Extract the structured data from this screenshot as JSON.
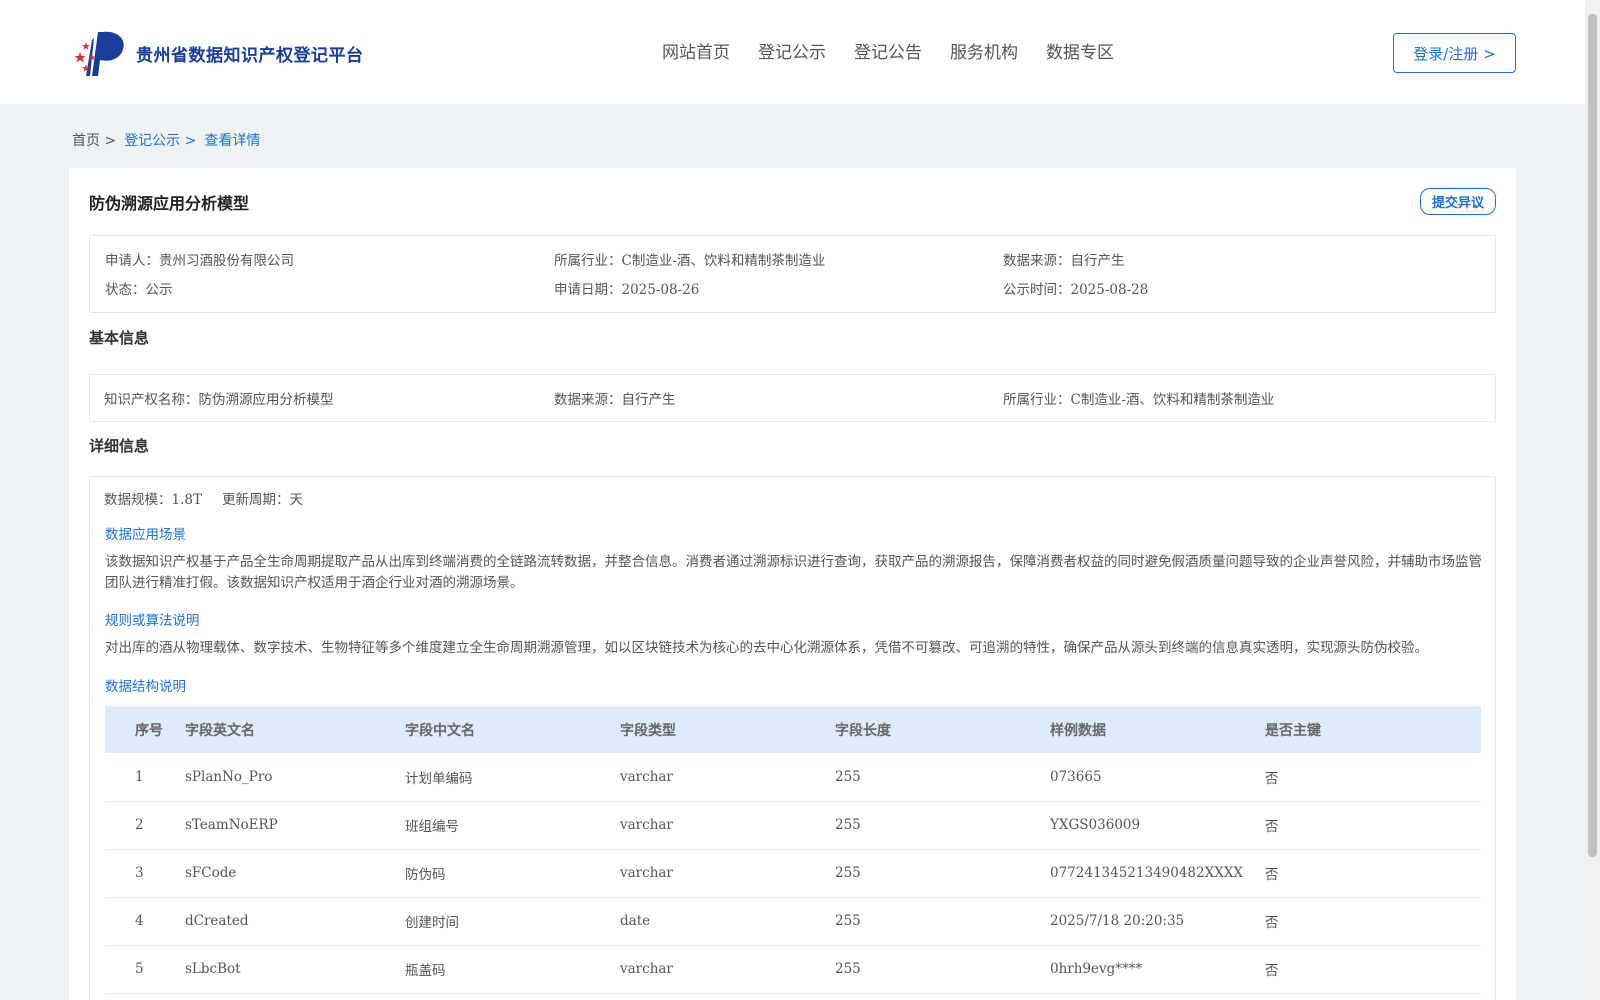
{
  "header": {
    "site_title": "贵州省数据知识产权登记平台",
    "nav": [
      "网站首页",
      "登记公示",
      "登记公告",
      "服务机构",
      "数据专区"
    ],
    "login_label": "登录/注册 >"
  },
  "breadcrumb": [
    "首页 >",
    "登记公示 >",
    "查看详情"
  ],
  "record": {
    "title": "防伪溯源应用分析模型",
    "objection_label": "提交异议",
    "summary": {
      "applicant_label": "申请人：",
      "applicant": "贵州习酒股份有限公司",
      "industry_label": "所属行业：",
      "industry": "C制造业-酒、饮料和精制茶制造业",
      "source_label": "数据来源：",
      "source": "自行产生",
      "status_label": "状态：",
      "status": "公示",
      "apply_date_label": "申请日期：",
      "apply_date": "2025-08-26",
      "publish_date_label": "公示时间：",
      "publish_date": "2025-08-28"
    }
  },
  "basic": {
    "title": "基本信息",
    "ip_name_label": "知识产权名称：",
    "ip_name": "防伪溯源应用分析模型",
    "source_label": "数据来源：",
    "source": "自行产生",
    "industry_label": "所属行业：",
    "industry": "C制造业-酒、饮料和精制茶制造业"
  },
  "detail": {
    "title": "详细信息",
    "scale_label": "数据规模：",
    "scale": "1.8T",
    "cycle_label": "更新周期：",
    "cycle": "天",
    "scenario_title": "数据应用场景",
    "scenario_text": "该数据知识产权基于产品全生命周期提取产品从出库到终端消费的全链路流转数据，并整合信息。消费者通过溯源标识进行查询，获取产品的溯源报告，保障消费者权益的同时避免假酒质量问题导致的企业声誉风险，并辅助市场监管团队进行精准打假。该数据知识产权适用于酒企行业对酒的溯源场景。",
    "rules_title": "规则或算法说明",
    "rules_text": "对出库的酒从物理载体、数字技术、生物特征等多个维度建立全生命周期溯源管理，如以区块链技术为核心的去中心化溯源体系，凭借不可篡改、可追溯的特性，确保产品从源头到终端的信息真实透明，实现源头防伪校验。",
    "structure_title": "数据结构说明",
    "table": {
      "headers": [
        "序号",
        "字段英文名",
        "字段中文名",
        "字段类型",
        "字段长度",
        "样例数据",
        "是否主键"
      ],
      "rows": [
        [
          "1",
          "sPlanNo_Pro",
          "计划单编码",
          "varchar",
          "255",
          "073665",
          "否"
        ],
        [
          "2",
          "sTeamNoERP",
          "班组编号",
          "varchar",
          "255",
          "YXGS036009",
          "否"
        ],
        [
          "3",
          "sFCode",
          "防伪码",
          "varchar",
          "255",
          "077241345213490482XXXX",
          "否"
        ],
        [
          "4",
          "dCreated",
          "创建时间",
          "date",
          "255",
          "2025/7/18 20:20:35",
          "否"
        ],
        [
          "5",
          "sLbcBot",
          "瓶盖码",
          "varchar",
          "255",
          "0hrh9evg****",
          "否"
        ]
      ]
    }
  },
  "colors": {
    "accent": "#1e6fd9",
    "brand": "#1a3c9a",
    "table_header_bg": "#deebfb",
    "page_bg": "#eff2f5"
  }
}
